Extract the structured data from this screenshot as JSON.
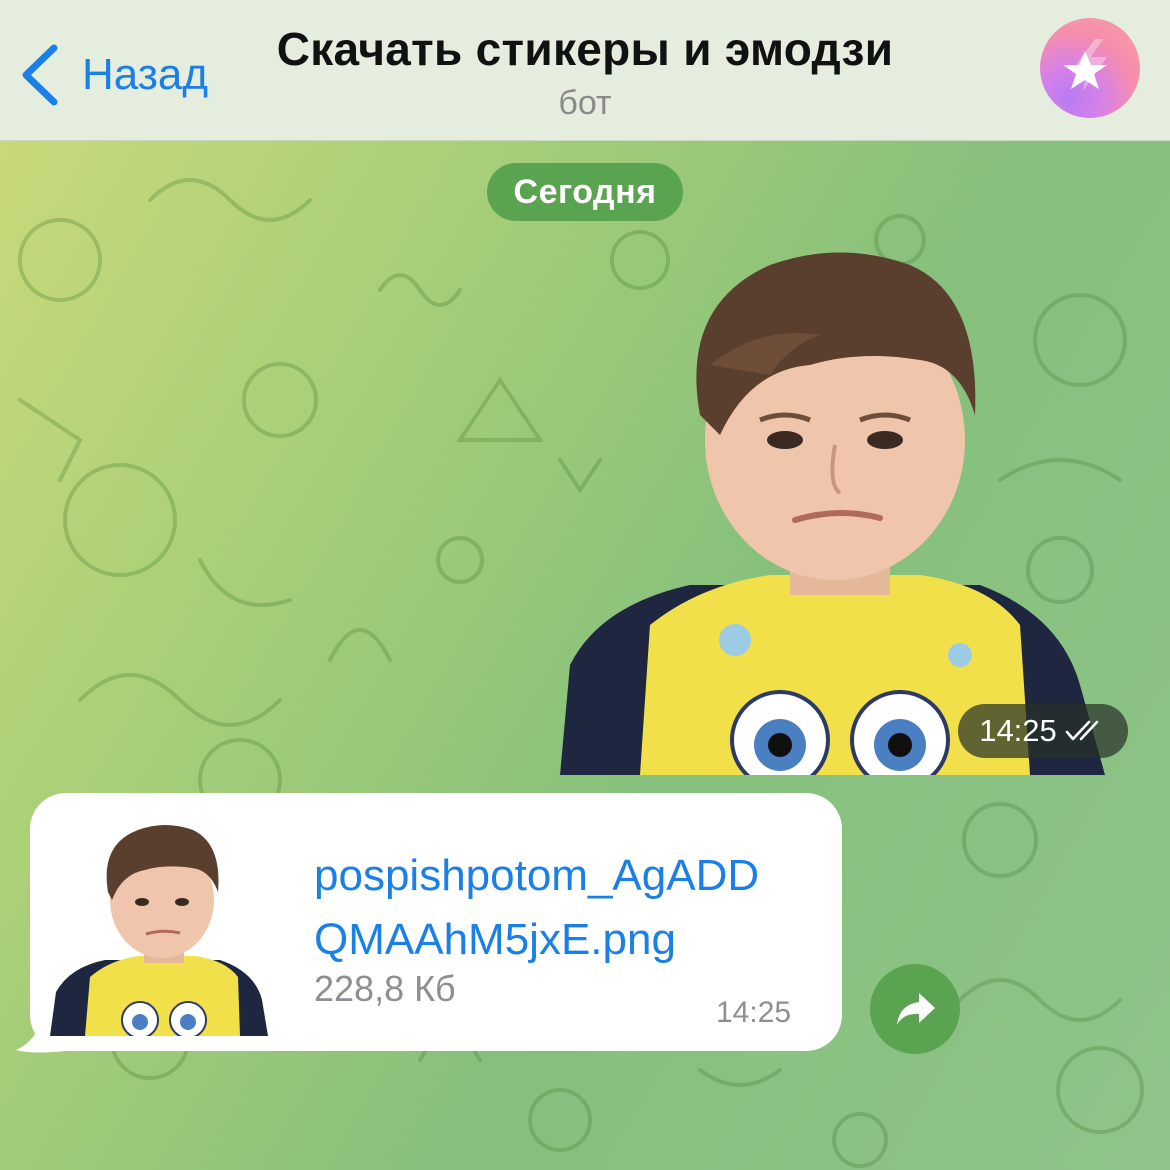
{
  "header": {
    "back_label": "Назад",
    "title": "Скачать стикеры и эмодзи",
    "subtitle": "бот"
  },
  "chat": {
    "date_label": "Сегодня",
    "sticker_message": {
      "time": "14:25",
      "status": "read"
    },
    "file_message": {
      "name_line1": "pospishpotom_AgADD",
      "name_line2": "QMAAhM5jxE.png",
      "size": "228,8 Кб",
      "time": "14:25"
    }
  },
  "colors": {
    "accent": "#1a7fe6",
    "pill_green": "#5aa350",
    "bubble_bg": "#ffffff",
    "header_bg": "#e5eddf"
  },
  "icons": {
    "back": "chevron-left-icon",
    "avatar": "bot-avatar-star-icon",
    "read_status": "double-check-icon",
    "share": "share-arrow-icon"
  }
}
